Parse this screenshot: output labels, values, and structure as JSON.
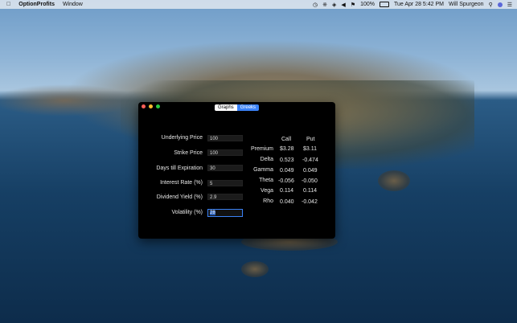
{
  "menubar": {
    "app_name": "OptionProfits",
    "menu_window": "Window",
    "battery": "100%",
    "datetime": "Tue Apr 28  5:42 PM",
    "user": "Will Spurgeon"
  },
  "window": {
    "tabs": [
      {
        "label": "Graphs",
        "selected": false
      },
      {
        "label": "Greeks",
        "selected": true
      }
    ]
  },
  "inputs": [
    {
      "label": "Underlying Price",
      "value": "100"
    },
    {
      "label": "Strike Price",
      "value": "100"
    },
    {
      "label": "Days till Expiration",
      "value": "30"
    },
    {
      "label": "Interest Rate (%)",
      "value": "5"
    },
    {
      "label": "Dividend Yield (%)",
      "value": "2.9"
    },
    {
      "label": "Volatility (%)",
      "value": "28"
    }
  ],
  "greeks": {
    "col_call": "Call",
    "col_put": "Put",
    "rows": [
      {
        "name": "Premium",
        "call": "$3.28",
        "put": "$3.11"
      },
      {
        "name": "Delta",
        "call": "0.523",
        "put": "-0.474"
      },
      {
        "name": "Gamma",
        "call": "0.049",
        "put": "0.049"
      },
      {
        "name": "Theta",
        "call": "-0.056",
        "put": "-0.050"
      },
      {
        "name": "Vega",
        "call": "0.114",
        "put": "0.114"
      },
      {
        "name": "Rho",
        "call": "0.040",
        "put": "-0.042"
      }
    ]
  },
  "colors": {
    "accent": "#3b82f6",
    "close": "#fe5f57",
    "minimize": "#febc2e",
    "zoom": "#28c840"
  }
}
